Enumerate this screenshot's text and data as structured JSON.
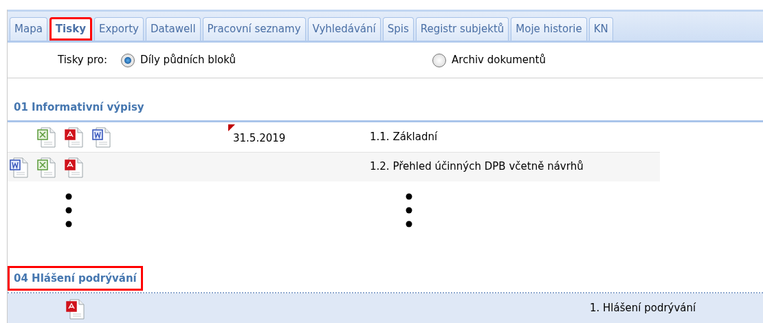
{
  "tabs": [
    {
      "label": "Mapa",
      "selected": false,
      "highlighted": false
    },
    {
      "label": "Tisky",
      "selected": true,
      "highlighted": true
    },
    {
      "label": "Exporty",
      "selected": false,
      "highlighted": false
    },
    {
      "label": "Datawell",
      "selected": false,
      "highlighted": false
    },
    {
      "label": "Pracovní seznamy",
      "selected": false,
      "highlighted": false
    },
    {
      "label": "Vyhledávání",
      "selected": false,
      "highlighted": false
    },
    {
      "label": "Spis",
      "selected": false,
      "highlighted": false
    },
    {
      "label": "Registr subjektů",
      "selected": false,
      "highlighted": false
    },
    {
      "label": "Moje historie",
      "selected": false,
      "highlighted": false
    },
    {
      "label": "KN",
      "selected": false,
      "highlighted": false
    }
  ],
  "print_for": {
    "label": "Tisky pro:",
    "options": [
      {
        "label": "Díly půdních bloků",
        "selected": true
      },
      {
        "label": "Archiv dokumentů",
        "selected": false
      }
    ]
  },
  "sections": [
    {
      "kind": "standard",
      "title": "01 Informativní výpisy",
      "highlighted": false,
      "rows": [
        {
          "indented": true,
          "icons": [
            {
              "kind": "xls"
            },
            {
              "kind": "pdf"
            },
            {
              "kind": "doc"
            }
          ],
          "flagged": true,
          "date": "31.5.2019",
          "name": "1.1. Základní",
          "selected": false
        },
        {
          "indented": false,
          "icons": [
            {
              "kind": "doc"
            },
            {
              "kind": "xls"
            },
            {
              "kind": "pdf"
            }
          ],
          "flagged": false,
          "name": "1.2. Přehled účinných DPB včetně návrhů",
          "selected": false
        }
      ],
      "more": true
    },
    {
      "kind": "report",
      "title": "04 Hlášení podrývání",
      "highlighted": true,
      "rows": [
        {
          "indented": true,
          "icons": [
            {
              "kind": "pdf"
            }
          ],
          "name": "1. Hlášení podrývání",
          "selected": true
        }
      ]
    }
  ]
}
